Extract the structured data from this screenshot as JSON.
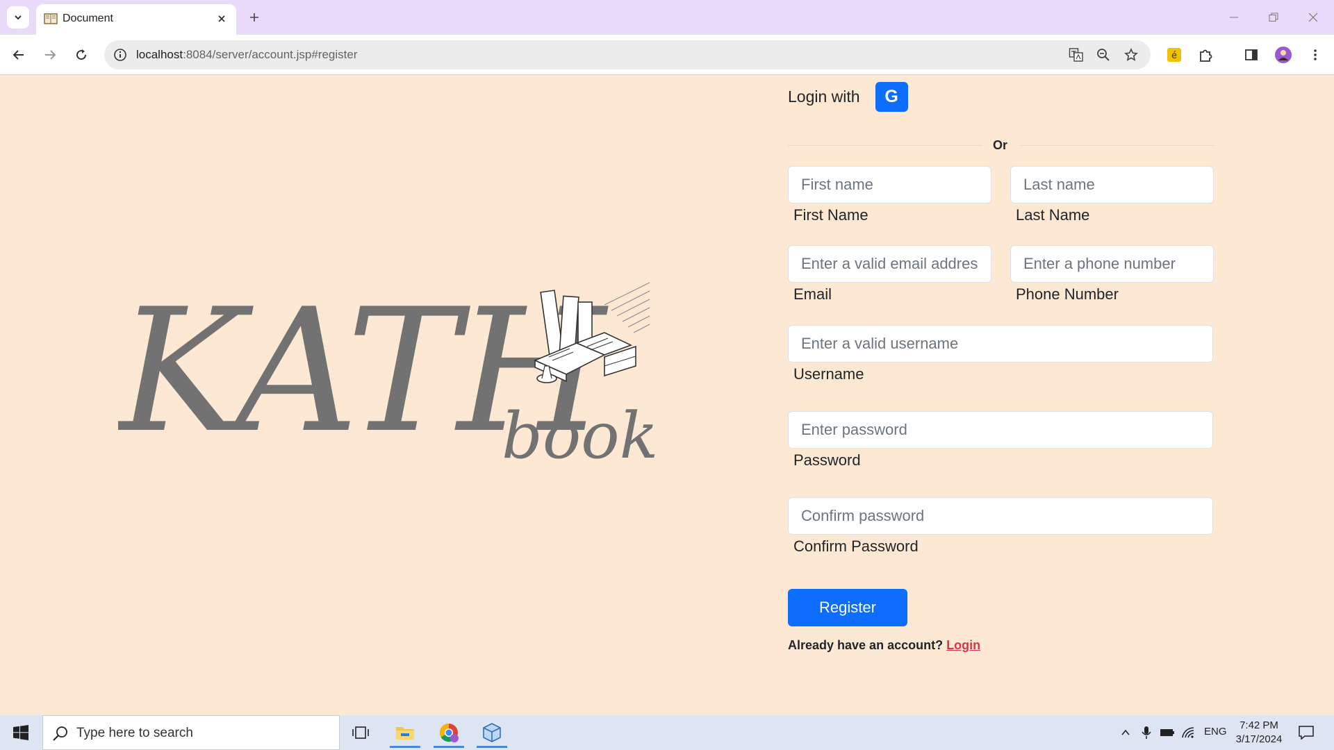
{
  "browser": {
    "tab_title": "Document",
    "url_host": "localhost",
    "url_rest": ":8084/server/account.jsp#register"
  },
  "page": {
    "logo_text": "KATH",
    "logo_sub": "book",
    "login_with": "Login with",
    "google_letter": "G",
    "divider_text": "Or",
    "fields": {
      "first_name": {
        "placeholder": "First name",
        "label": "First Name"
      },
      "last_name": {
        "placeholder": "Last name",
        "label": "Last Name"
      },
      "email": {
        "placeholder": "Enter a valid email address",
        "label": "Email"
      },
      "phone": {
        "placeholder": "Enter a phone number",
        "label": "Phone Number"
      },
      "username": {
        "placeholder": "Enter a valid username",
        "label": "Username"
      },
      "password": {
        "placeholder": "Enter password",
        "label": "Password"
      },
      "confirm_password": {
        "placeholder": "Confirm password",
        "label": "Confirm Password"
      }
    },
    "register_label": "Register",
    "already_text": "Already have an account?",
    "login_link": "Login"
  },
  "taskbar": {
    "search_placeholder": "Type here to search",
    "language": "ENG",
    "time": "7:42 PM",
    "date": "3/17/2024"
  },
  "colors": {
    "page_bg": "#fde8d4",
    "primary": "#0d6efd",
    "link": "#dc3545",
    "logo": "#727272"
  }
}
